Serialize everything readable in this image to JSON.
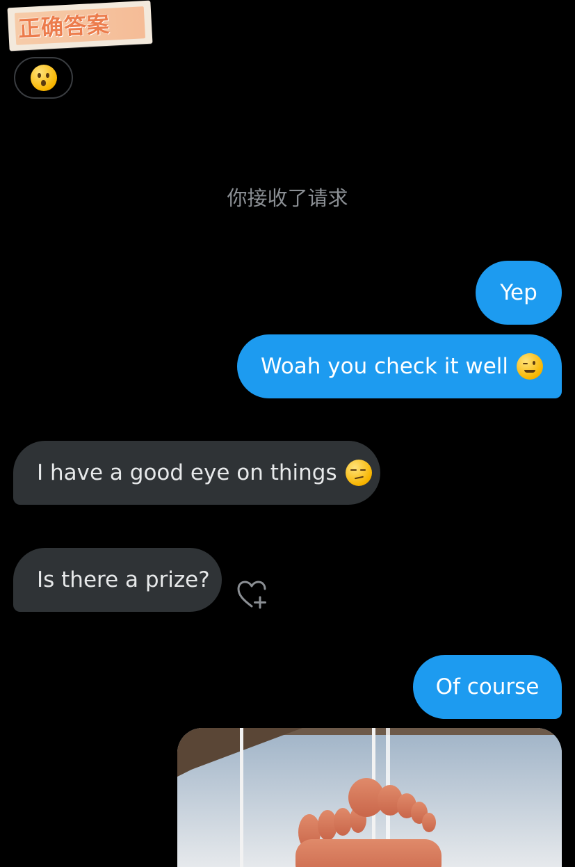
{
  "sticker": {
    "text": "正确答案"
  },
  "reaction": {
    "emoji": "😲",
    "icon": "hushed-face-icon"
  },
  "conversation": {
    "system_message": "你接收了请求",
    "messages": [
      {
        "side": "sent",
        "text": "Yep"
      },
      {
        "side": "sent",
        "text": "Woah you check it well",
        "emoji": "😉"
      },
      {
        "side": "received",
        "text": "I have a good eye on things",
        "emoji": "😏"
      },
      {
        "side": "received",
        "text": "Is there a prize?"
      },
      {
        "side": "sent",
        "text": "Of course"
      }
    ],
    "add_reaction_icon": "heart-plus-icon"
  },
  "colors": {
    "background": "#000000",
    "sent_bubble": "#1d9bf0",
    "received_bubble": "#2f3336",
    "system_text": "#8b8f94"
  }
}
